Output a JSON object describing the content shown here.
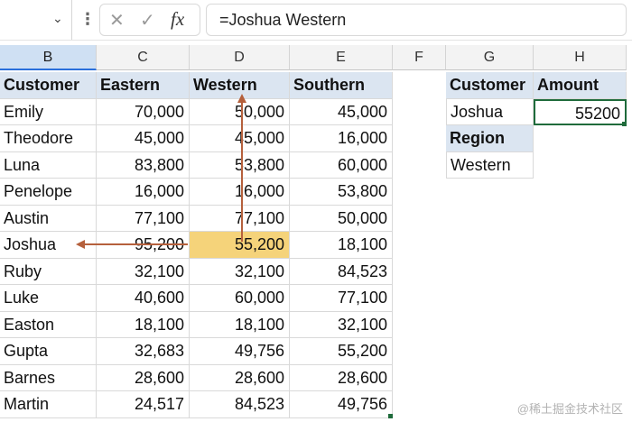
{
  "formula_bar": {
    "name_box_value": "",
    "cancel_symbol": "✕",
    "enter_symbol": "✓",
    "fx_label": "fx",
    "formula_text": "=Joshua Western"
  },
  "columns": [
    "B",
    "C",
    "D",
    "E",
    "F",
    "G",
    "H"
  ],
  "table": {
    "headers": [
      "Customer",
      "Eastern",
      "Western",
      "Southern"
    ],
    "rows": [
      [
        "Emily",
        "70,000",
        "50,000",
        "45,000"
      ],
      [
        "Theodore",
        "45,000",
        "45,000",
        "16,000"
      ],
      [
        "Luna",
        "83,800",
        "53,800",
        "60,000"
      ],
      [
        "Penelope",
        "16,000",
        "16,000",
        "53,800"
      ],
      [
        "Austin",
        "77,100",
        "77,100",
        "50,000"
      ],
      [
        "Joshua",
        "95,200",
        "55,200",
        "18,100"
      ],
      [
        "Ruby",
        "32,100",
        "32,100",
        "84,523"
      ],
      [
        "Luke",
        "40,600",
        "60,000",
        "77,100"
      ],
      [
        "Easton",
        "18,100",
        "18,100",
        "32,100"
      ],
      [
        "Gupta",
        "32,683",
        "49,756",
        "55,200"
      ],
      [
        "Barnes",
        "28,600",
        "28,600",
        "28,600"
      ],
      [
        "Martin",
        "24,517",
        "84,523",
        "49,756"
      ]
    ]
  },
  "lookup": {
    "customer_label": "Customer",
    "amount_label": "Amount",
    "customer_value": "Joshua",
    "amount_value": "55200",
    "region_label": "Region",
    "region_value": "Western"
  },
  "watermark": "@稀土掘金技术社区",
  "colors": {
    "header_fill": "#dbe5f1",
    "highlight_fill": "#f5d37a",
    "arrow": "#b5603c",
    "active_border": "#1f6b3b"
  }
}
